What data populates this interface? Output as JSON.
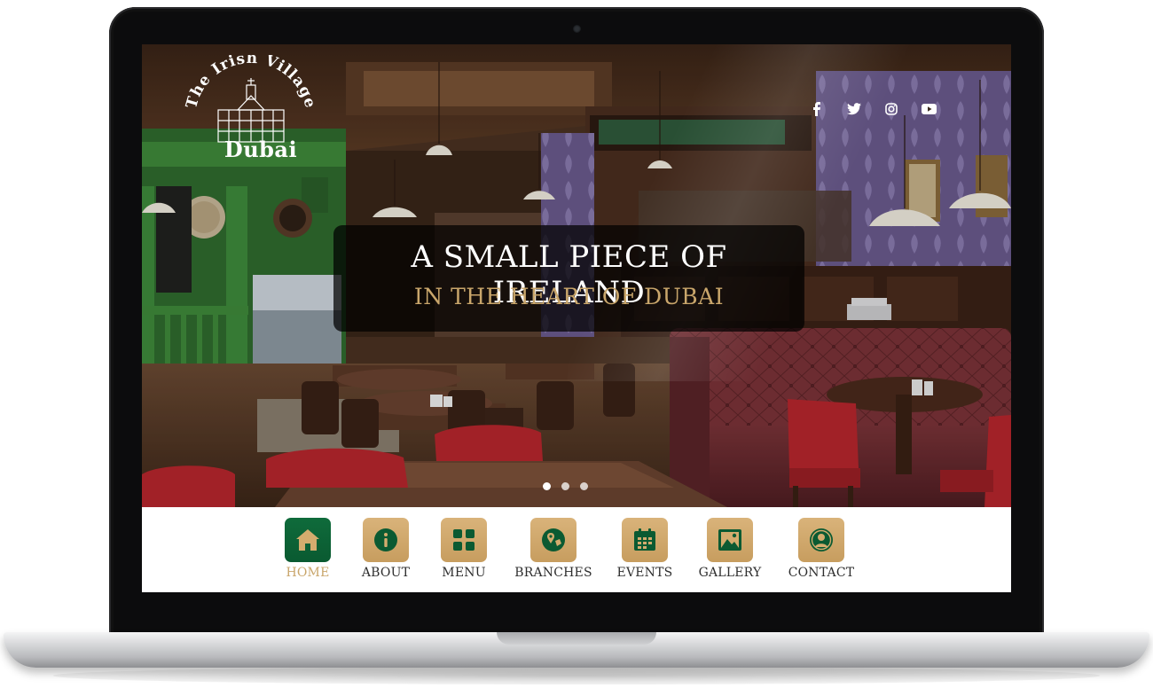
{
  "brand": {
    "logo_text": "The Irish Village",
    "logo_city": "Dubai"
  },
  "social": [
    {
      "icon": "facebook-icon"
    },
    {
      "icon": "twitter-icon"
    },
    {
      "icon": "instagram-icon"
    },
    {
      "icon": "youtube-icon"
    }
  ],
  "hero": {
    "headline": "A SMALL PIECE OF IRELAND",
    "subheadline": "IN THE HEART OF DUBAI",
    "slides": 3,
    "active_slide": 1
  },
  "nav": {
    "items": [
      {
        "label": "HOME",
        "icon": "home-icon",
        "active": true
      },
      {
        "label": "ABOUT",
        "icon": "info-icon",
        "active": false
      },
      {
        "label": "MENU",
        "icon": "grid-icon",
        "active": false
      },
      {
        "label": "BRANCHES",
        "icon": "map-pin-icon",
        "active": false
      },
      {
        "label": "EVENTS",
        "icon": "calendar-icon",
        "active": false
      },
      {
        "label": "GALLERY",
        "icon": "image-icon",
        "active": false
      },
      {
        "label": "CONTACT",
        "icon": "user-icon",
        "active": false
      }
    ]
  },
  "colors": {
    "accent_gold": "#c9a66b",
    "tile_gold": "#d4ac6e",
    "active_green": "#0f6b3b",
    "icon_green": "#0b5a32"
  }
}
